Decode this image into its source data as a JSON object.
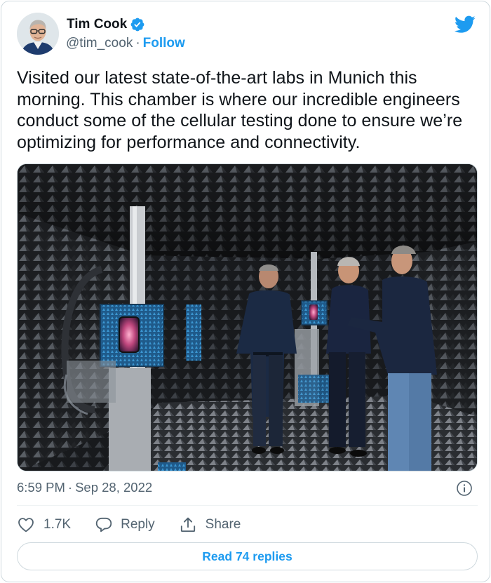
{
  "author": {
    "display_name": "Tim Cook",
    "handle": "@tim_cook",
    "separator": "·",
    "follow_label": "Follow",
    "verified": true
  },
  "tweet": {
    "text": "Visited our latest state-of-the-art labs in Munich this morning. This chamber is where our incredible engineers conduct some of the cellular testing done to ensure we’re optimizing for performance and connectivity.",
    "time": "6:59 PM",
    "separator": "·",
    "date": "Sep 28, 2022"
  },
  "actions": {
    "like_count": "1.7K",
    "reply_label": "Reply",
    "share_label": "Share"
  },
  "read_replies_label": "Read 74 replies",
  "icons": {
    "bird": "twitter-bird-icon",
    "verified": "verified-badge-icon",
    "info": "info-icon",
    "like": "heart-icon",
    "reply": "speech-bubble-icon",
    "share": "share-upload-icon"
  },
  "colors": {
    "accent": "#1d9bf0",
    "text": "#0f1419",
    "secondary": "#536471",
    "border": "#cfd9de"
  }
}
